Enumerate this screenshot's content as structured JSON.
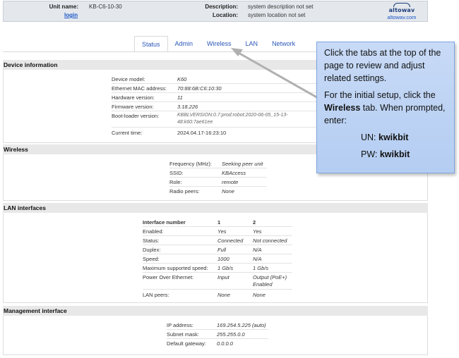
{
  "header": {
    "unit_name_label": "Unit name:",
    "unit_name_value": "KB-C6-10-30",
    "login_label": "login",
    "description_label": "Description:",
    "description_value": "system description not set",
    "location_label": "Location:",
    "location_value": "system location not set",
    "logo_text": "altowav",
    "logo_url": "altowav.com"
  },
  "tabs": [
    {
      "label": "Status",
      "active": true
    },
    {
      "label": "Admin"
    },
    {
      "label": "Wireless"
    },
    {
      "label": "LAN"
    },
    {
      "label": "Network"
    }
  ],
  "device_info": {
    "title": "Device information",
    "rows": [
      {
        "k": "Device model:",
        "v": "K60"
      },
      {
        "k": "Ethernet MAC address:",
        "v": "70:88:6B:C6:10:30"
      },
      {
        "k": "Hardware version:",
        "v": "11"
      },
      {
        "k": "Firmware version:",
        "v": "3.18.226"
      },
      {
        "k": "Boot-loader version:",
        "v": "KBBLVERSION:0.7:prod:robot:2020-06-05_15-13-48:k60:7ae61ee"
      },
      {
        "k": "Current time:",
        "v": "2024.04.17-16:23:10"
      }
    ]
  },
  "wireless": {
    "title": "Wireless",
    "rows": [
      {
        "k": "Frequency (MHz):",
        "v": "Seeking peer unit"
      },
      {
        "k": "SSID:",
        "v": "KBAccess"
      },
      {
        "k": "Role:",
        "v": "remote"
      },
      {
        "k": "Radio peers:",
        "v": "None"
      }
    ]
  },
  "lan": {
    "title": "LAN interfaces",
    "header": {
      "k": "Interface number",
      "c1": "1",
      "c2": "2"
    },
    "rows": [
      {
        "k": "Enabled:",
        "c1": "Yes",
        "c2": "Yes"
      },
      {
        "k": "Status:",
        "c1": "Connected",
        "c2": "Not connected"
      },
      {
        "k": "Duplex:",
        "c1": "Full",
        "c2": "N/A"
      },
      {
        "k": "Speed:",
        "c1": "1000",
        "c2": "N/A"
      },
      {
        "k": "Maximum supported speed:",
        "c1": "1 Gb/s",
        "c2": "1 Gb/s"
      },
      {
        "k": "Power Over Ethernet:",
        "c1": "Input",
        "c2": "Output (PoE+) Enabled"
      },
      {
        "k": "LAN peers:",
        "c1": "None",
        "c2": "None"
      }
    ]
  },
  "mgmt": {
    "title": "Management interface",
    "rows": [
      {
        "k": "IP address:",
        "v": "169.254.5.225 (auto)"
      },
      {
        "k": "Subnet mask:",
        "v": "255.255.0.0"
      },
      {
        "k": "Default gateway:",
        "v": "0.0.0.0"
      }
    ]
  },
  "callout": {
    "p1": "Click the tabs at the top of the page to review and adjust related settings.",
    "p2_pre": "For the initial setup, click the ",
    "p2_bold": "Wireless",
    "p2_post": " tab. When prompted, enter:",
    "un_label": "UN: ",
    "un_value": "kwikbit",
    "pw_label": "PW: ",
    "pw_value": "kwikbit"
  }
}
